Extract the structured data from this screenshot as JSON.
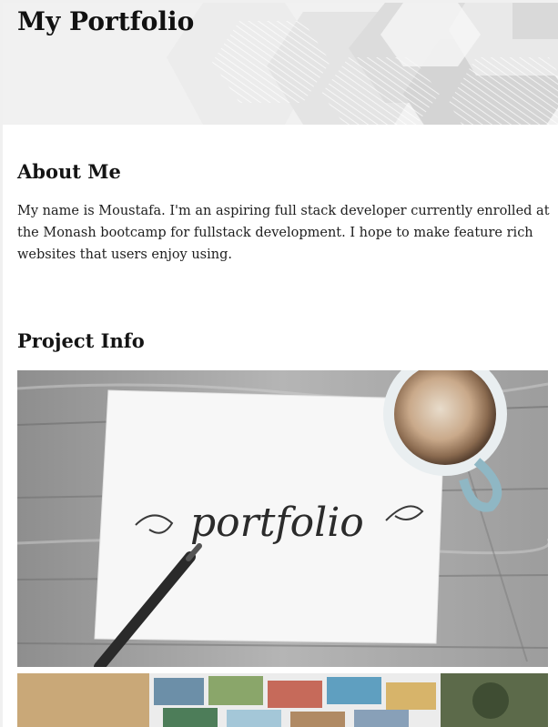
{
  "header": {
    "title": "My Portfolio"
  },
  "about": {
    "heading": "About Me",
    "body": "My name is Moustafa. I'm an aspiring full stack developer currently enrolled at the Monash bootcamp for fullstack development. I hope to make feature rich websites that users enjoy using."
  },
  "projects": {
    "heading": "Project Info",
    "images": [
      {
        "name": "portfolio-image",
        "caption_in_image": "portfolio"
      },
      {
        "name": "project-thumbnail-image"
      }
    ]
  },
  "colors": {
    "banner_light": "#f4f4f4",
    "banner_dark": "#d9d9d9",
    "text": "#141414",
    "background": "#ffffff"
  }
}
